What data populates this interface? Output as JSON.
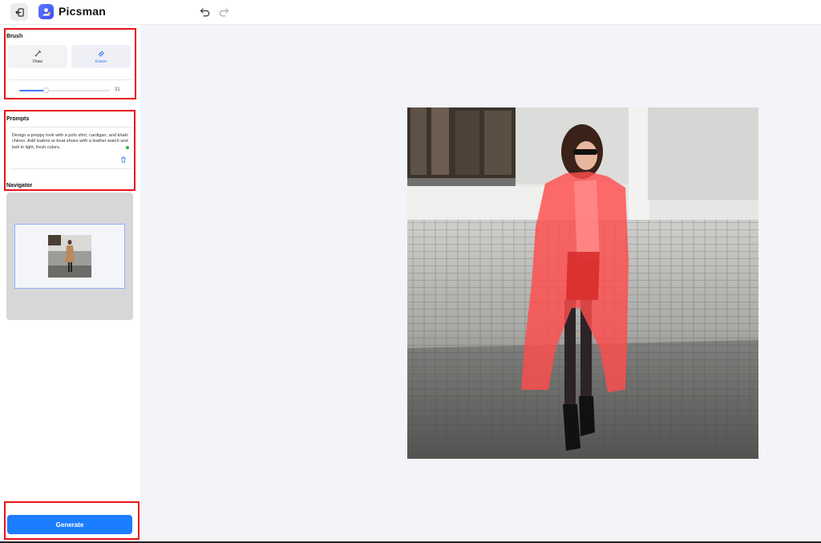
{
  "app": {
    "name": "Picsman"
  },
  "brush": {
    "title": "Brush",
    "tools": [
      {
        "label": "Draw",
        "active": false
      },
      {
        "label": "Eraser",
        "active": true
      }
    ],
    "size": 31,
    "size_fraction": 0.3
  },
  "prompts": {
    "title": "Prompts",
    "text": "Design a preppy look with a polo shirt, cardigan, and khaki chinos. Add loafers or boat shoes with a leather watch and belt in light, fresh colors."
  },
  "navigator": {
    "title": "Navigator"
  },
  "generate": {
    "label": "Generate"
  },
  "colors": {
    "accent": "#1b7dff",
    "highlight_box": "#e8141c",
    "mask": "#ff4d4d"
  },
  "icons": [
    "exit-icon",
    "picsman-logo-icon",
    "undo-icon",
    "redo-icon",
    "brush-draw-icon",
    "eraser-icon",
    "trash-icon"
  ]
}
